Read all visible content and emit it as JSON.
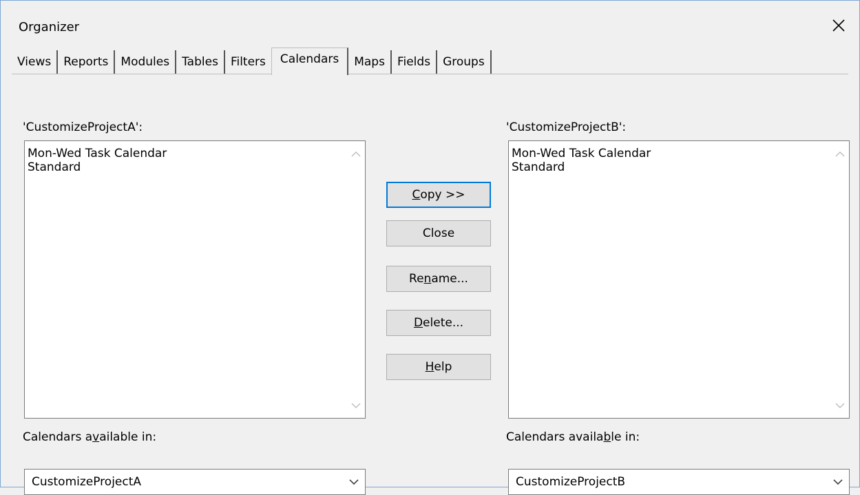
{
  "window": {
    "title": "Organizer"
  },
  "tabs": [
    {
      "label": "Views"
    },
    {
      "label": "Reports"
    },
    {
      "label": "Modules"
    },
    {
      "label": "Tables"
    },
    {
      "label": "Filters"
    },
    {
      "label": "Calendars",
      "active": true
    },
    {
      "label": "Maps"
    },
    {
      "label": "Fields"
    },
    {
      "label": "Groups"
    }
  ],
  "left": {
    "project_label": "'CustomizeProjectA':",
    "items": [
      "Mon-Wed Task Calendar",
      "Standard"
    ],
    "available_label_pre": "Calendars a",
    "available_label_mn": "v",
    "available_label_post": "ailable in:",
    "combo_value": "CustomizeProjectA"
  },
  "right": {
    "project_label": "'CustomizeProjectB':",
    "items": [
      "Mon-Wed Task Calendar",
      "Standard"
    ],
    "available_label_pre": "Calendars availa",
    "available_label_mn": "b",
    "available_label_post": "le in:",
    "combo_value": "CustomizeProjectB"
  },
  "buttons": {
    "copy": {
      "mn": "C",
      "rest": "opy >>"
    },
    "close": {
      "label": "Close"
    },
    "rename": {
      "pre": "Re",
      "mn": "n",
      "post": "ame..."
    },
    "delete": {
      "mn": "D",
      "rest": "elete..."
    },
    "help": {
      "mn": "H",
      "rest": "elp"
    }
  },
  "icons": {
    "close": "close-icon",
    "scroll_up": "chevron-up-icon",
    "scroll_down": "chevron-down-icon",
    "dropdown": "chevron-down-icon"
  },
  "colors": {
    "accent": "#0078d7",
    "dialog_bg": "#f0f0f0"
  }
}
